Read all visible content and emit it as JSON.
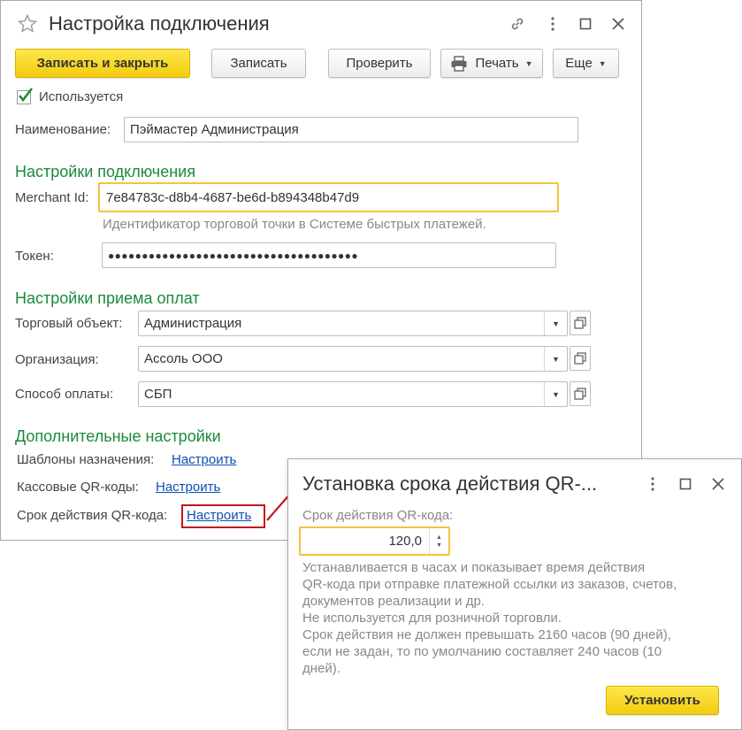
{
  "main": {
    "title": "Настройка подключения",
    "toolbar": {
      "save_close": "Записать и закрыть",
      "save": "Записать",
      "check": "Проверить",
      "print": "Печать",
      "more": "Еще"
    },
    "used_label": "Используется",
    "name_label": "Наименование:",
    "name_value": "Пэймастер Администрация",
    "section_connection": "Настройки подключения",
    "merchant_label": "Merchant Id:",
    "merchant_value": "7e84783c-d8b4-4687-be6d-b894348b47d9",
    "merchant_hint": "Идентификатор торговой точки в Системе быстрых платежей.",
    "token_label": "Токен:",
    "token_value": "●●●●●●●●●●●●●●●●●●●●●●●●●●●●●●●●●●●●●",
    "section_payments": "Настройки приема оплат",
    "store_label": "Торговый объект:",
    "store_value": "Администрация",
    "org_label": "Организация:",
    "org_value": "Ассоль ООО",
    "pay_label": "Способ оплаты:",
    "pay_value": "СБП",
    "section_additional": "Дополнительные настройки",
    "templates_label": "Шаблоны назначения:",
    "qr_label": "Кассовые QR-коды:",
    "ttl_label": "Срок действия QR-кода:",
    "configure_link": "Настроить"
  },
  "popup": {
    "title": "Установка срока действия QR-...",
    "field_label": "Срок действия QR-кода:",
    "field_value": "120,0",
    "description": [
      "Устанавливается в часах и показывает время действия",
      "QR-кода при отправке платежной ссылки из заказов, счетов,",
      "документов реализации и др.",
      "Не используется для розничной торговли.",
      "Срок действия не должен превышать 2160 часов (90 дней),",
      "если не задан, то по умолчанию составляет 240 часов (10",
      "дней)."
    ],
    "set_button": "Установить"
  },
  "colors": {
    "accent_yellow": "#f5d11c",
    "section_green": "#1a8a3a",
    "link_blue": "#0b4fb3",
    "highlight_red": "#c3161c",
    "focus_border": "#f3c53a"
  }
}
